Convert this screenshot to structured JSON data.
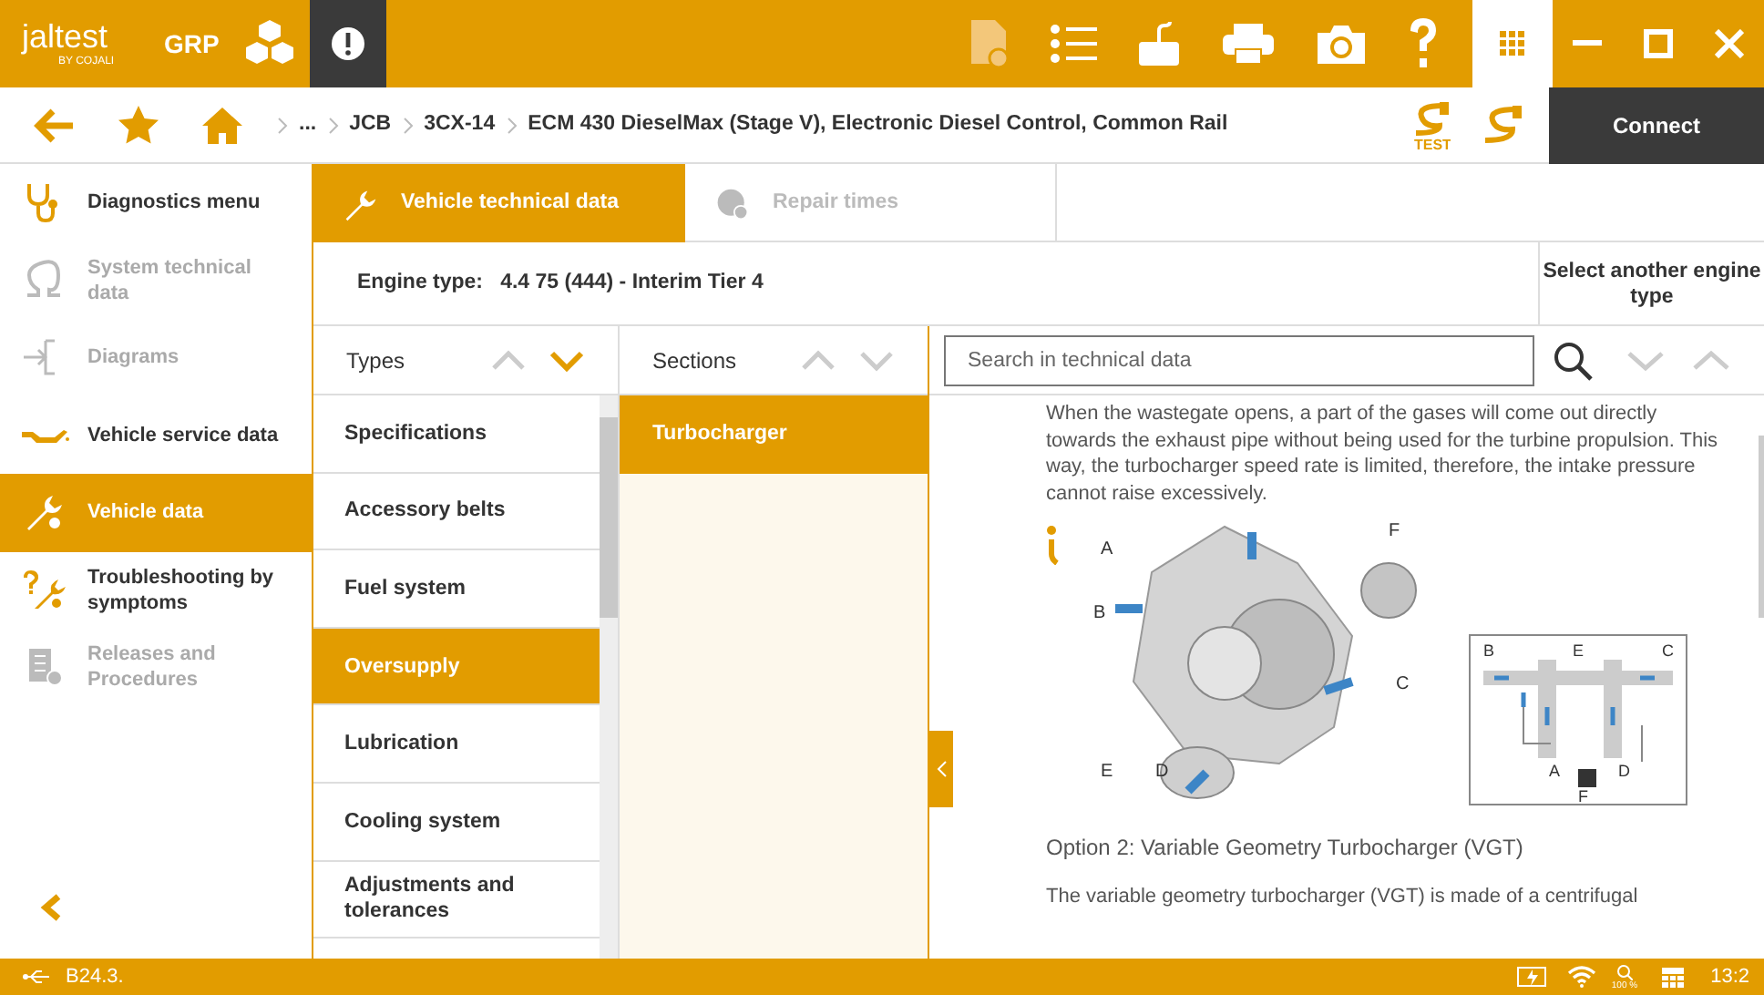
{
  "app": {
    "logo": "jaltest",
    "logo_sub": "BY COJALI",
    "product": "GRP"
  },
  "breadcrumb": [
    "...",
    "JCB",
    "3CX-14",
    "ECM 430 DieselMax (Stage V), Electronic Diesel Control, Common Rail"
  ],
  "test_cable_label": "TEST",
  "connect_button": "Connect",
  "sidebar": [
    {
      "label": "Diagnostics menu",
      "kind": "diag",
      "selected": false,
      "disabled": false
    },
    {
      "label": "System technical data",
      "kind": "omega",
      "selected": false,
      "disabled": true
    },
    {
      "label": "Diagrams",
      "kind": "diagram",
      "selected": false,
      "disabled": true
    },
    {
      "label": "Vehicle service data",
      "kind": "oil",
      "selected": false,
      "disabled": false
    },
    {
      "label": "Vehicle data",
      "kind": "wrench",
      "selected": true,
      "disabled": false
    },
    {
      "label": "Troubleshooting by symptoms",
      "kind": "trouble",
      "selected": false,
      "disabled": false
    },
    {
      "label": "Releases and Procedures",
      "kind": "doc",
      "selected": false,
      "disabled": true
    }
  ],
  "tabs": [
    {
      "label": "Vehicle technical data",
      "selected": true,
      "disabled": false
    },
    {
      "label": "Repair times",
      "selected": false,
      "disabled": true
    }
  ],
  "engine": {
    "label": "Engine type:",
    "value": "4.4 75 (444) - Interim Tier 4",
    "button": "Select another engine type"
  },
  "types": {
    "title": "Types",
    "items": [
      {
        "label": "Specifications",
        "selected": false
      },
      {
        "label": "Accessory belts",
        "selected": false
      },
      {
        "label": "Fuel system",
        "selected": false
      },
      {
        "label": "Oversupply",
        "selected": true
      },
      {
        "label": "Lubrication",
        "selected": false
      },
      {
        "label": "Cooling system",
        "selected": false
      },
      {
        "label": "Adjustments and tolerances",
        "selected": false
      }
    ]
  },
  "sections": {
    "title": "Sections",
    "items": [
      {
        "label": "Turbocharger",
        "selected": true
      }
    ]
  },
  "search": {
    "placeholder": "Search in technical data"
  },
  "content": {
    "paragraph_1": "When the wastegate opens, a part of the gases will come out directly towards the exhaust pipe without being used for the turbine propulsion. This way, the turbocharger speed rate is limited, therefore, the intake pressure cannot raise excessively.",
    "diagram_labels": [
      "F",
      "A",
      "B",
      "C",
      "E",
      "D"
    ],
    "inset_labels": [
      "B",
      "E",
      "C",
      "A",
      "D",
      "F"
    ],
    "heading": "Option 2: Variable Geometry Turbocharger (VGT)",
    "paragraph_2": "The variable geometry turbocharger (VGT) is made of a centrifugal"
  },
  "status_bar": {
    "version": "B24.3.",
    "zoom": "100 %",
    "time": "13:2"
  }
}
